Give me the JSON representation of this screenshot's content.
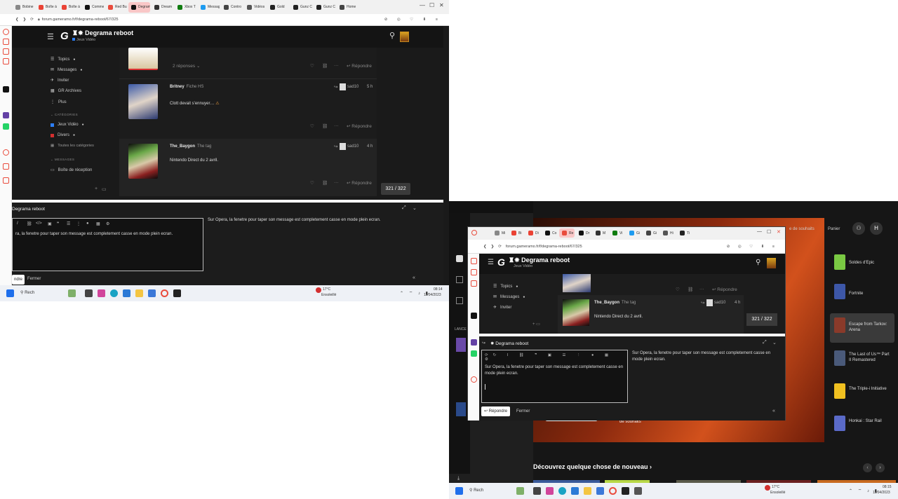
{
  "left": {
    "tabs": [
      "Bobine",
      "Boîte à",
      "Boîte à",
      "Comme",
      "Red Bu",
      "Degrama",
      "Dream",
      "Xbox T",
      "Messag",
      "Contro",
      "Vidéos",
      "Gold",
      "Gunz C",
      "Gunz C",
      "Home"
    ],
    "address": "forum.gameramo.fr/f/degrama-reboot/67/325",
    "site": {
      "title": "Degrama reboot",
      "subtitle": "Jeux Vidéo"
    },
    "nav": {
      "topics": "Topics",
      "messages": "Messages",
      "invite": "Inviter",
      "archives": "GR Archives",
      "plus": "Plus",
      "categories_header": "CATÉGORIES",
      "cat_jeux": "Jeux Vidéo",
      "cat_divers": "Divers",
      "cat_all": "Toutes les catégories",
      "messages_header": "MESSAGES",
      "inbox": "Boîte de réception"
    },
    "posts": [
      {
        "replies": "2 réponses",
        "reply": "Répondre"
      },
      {
        "author": "Britney",
        "tag": "Fiche HS",
        "reaction_user": "sad10",
        "time": "5 h",
        "text": "Clott devait s'ennuyer…",
        "reply": "Répondre"
      },
      {
        "author": "The_Baygon",
        "tag": "The tag",
        "reaction_user": "sad10",
        "time": "4 h",
        "text": "Nintendo Direct du 2 avril.",
        "reply": "Répondre"
      }
    ],
    "counter": "321 / 322",
    "editor": {
      "title": "Degrama reboot",
      "text": "ra, la fenetre pour taper son message est completement casse en mode plein ecran.",
      "preview": "Sur Opera,  la fenetre pour taper son message est completement casse en mode plein ecran.",
      "submit": "ndre",
      "close": "Fermer"
    },
    "taskbar": {
      "search": "Rech",
      "weather": "17°C",
      "weather_sub": "Ensoleillé",
      "time": "08:14",
      "date": "11/04/2023"
    }
  },
  "right": {
    "tabs": [
      "Mi",
      "Bi",
      "Di",
      "Co",
      "Re",
      "Dr",
      "M",
      "Vi",
      "Gi",
      "Gi",
      "Hi",
      "Ti"
    ],
    "address": "forum.gameramo.fr/f/degrama-reboot/67/325",
    "store_header": {
      "wishlist": "e de souhaits",
      "cart": "Panier",
      "avatar": "H"
    },
    "sidebar_label": "LANCE",
    "games": [
      {
        "name": "Soldes d'Epic"
      },
      {
        "name": "Fortnite"
      },
      {
        "name": "Escape from Tarkov: Arena"
      },
      {
        "name": "The Last of Us™ Part II Remastered"
      },
      {
        "name": "The Triple-i Initiative"
      },
      {
        "name": "Honkai : Star Rail"
      }
    ],
    "wishlist_label": "de souhaits",
    "discover": "Découvrez quelque chose de nouveau",
    "inner": {
      "site_title": "Degrama reboot",
      "site_subtitle": "Jeux Vidéo",
      "nav": [
        "Topics",
        "Messages",
        "Inviter"
      ],
      "post_author": "The_Baygon",
      "post_tag": "The tag",
      "reaction_user": "sad10",
      "time": "4 h",
      "post_text": "Nintendo Direct du 2 avril.",
      "reply": "Répondre",
      "counter": "321 / 322",
      "editor_title": "Degrama reboot",
      "editor_text": "Sur Opera, la fenetre pour taper son message est completement casse en mode plein ecran.",
      "preview": "Sur Opera, la fenetre pour taper son message est completement casse en mode plein ecran.",
      "submit": "Répondre",
      "close": "Fermer"
    },
    "taskbar": {
      "search": "Rech",
      "weather": "17°C",
      "weather_sub": "Ensoleillé",
      "time": "08:15",
      "date": "11/04/2023"
    }
  },
  "colors": {
    "accent": "#e94b3c",
    "dark": "#1a1a1a",
    "jeux": "#2d7ff9",
    "divers": "#d32f2f"
  }
}
